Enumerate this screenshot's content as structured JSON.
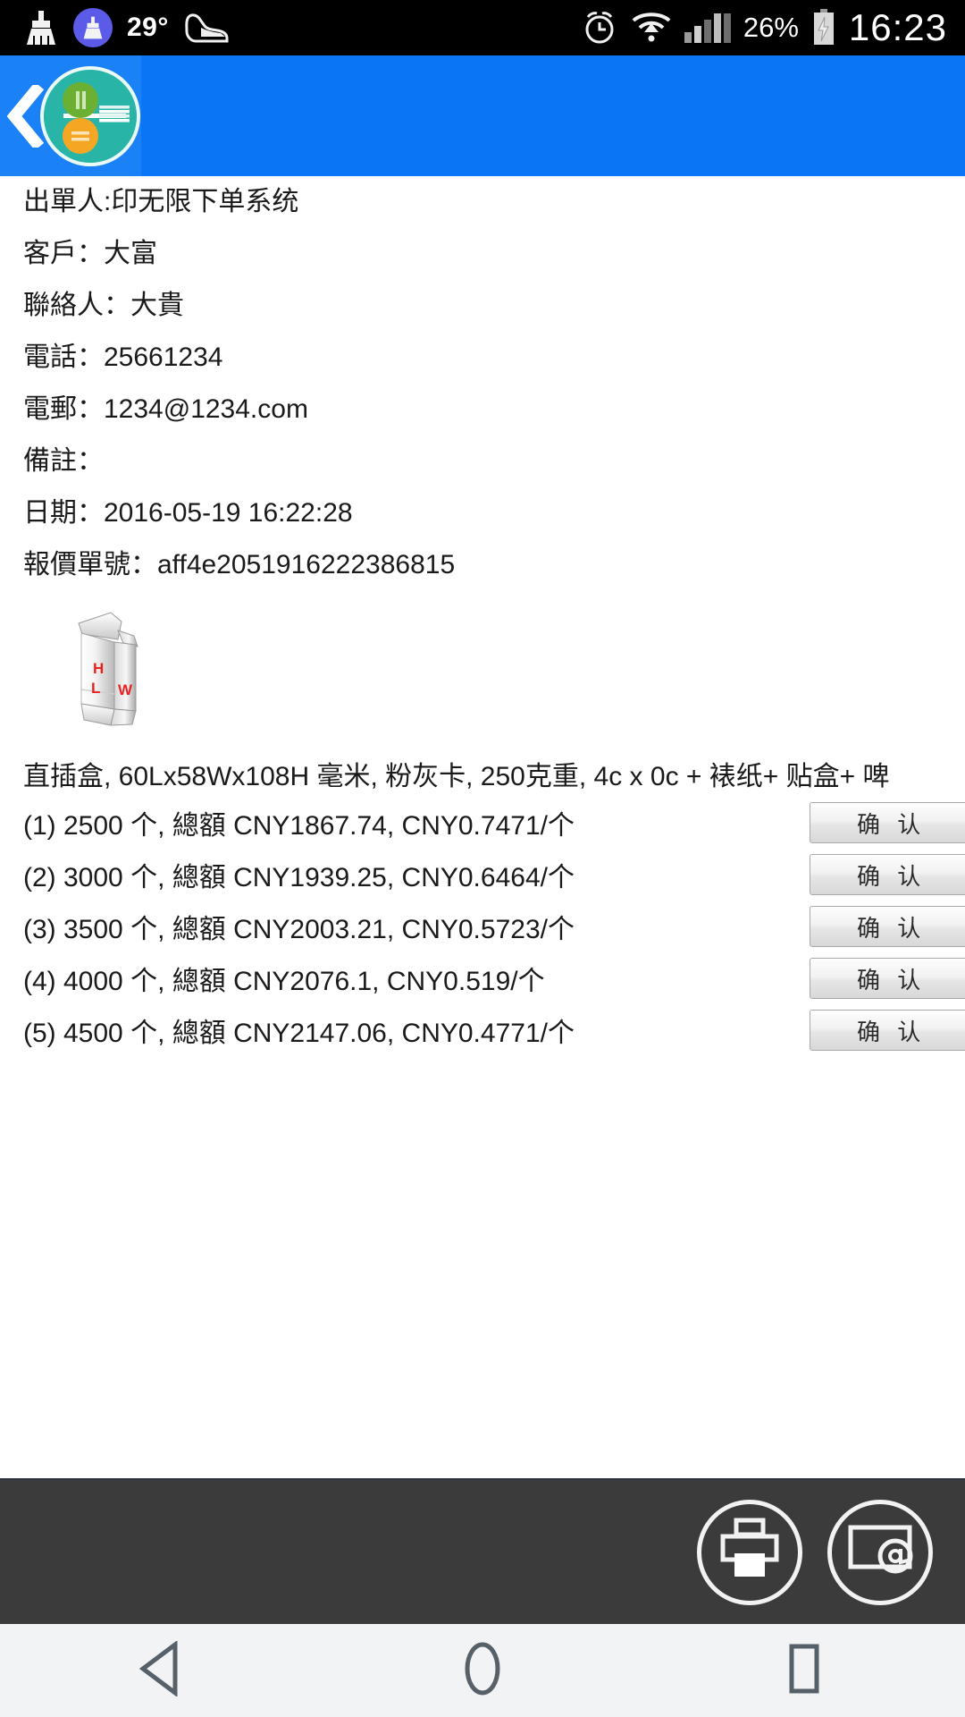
{
  "status_bar": {
    "temperature": "29°",
    "battery_percent": "26%",
    "clock": "16:23",
    "icons": [
      "broom-icon",
      "broom-badge-icon",
      "shoe-icon",
      "alarm-icon",
      "wifi-icon",
      "signal-icon",
      "battery-charging-icon"
    ]
  },
  "app_bar": {
    "back_label": "chevron-left-icon",
    "logo_label": "app-logo"
  },
  "order": {
    "issuer_label": "出單人:",
    "issuer_value": "印无限下单系统",
    "customer_label": "客戶：",
    "customer_value": "大富",
    "contact_label": "聯絡人：",
    "contact_value": "大貴",
    "phone_label": "電話：",
    "phone_value": "25661234",
    "email_label": "電郵：",
    "email_value": "1234@1234.com",
    "remark_label": "備註：",
    "remark_value": "",
    "date_label": "日期：",
    "date_value": "2016-05-19 16:22:28",
    "quote_label": "報價單號：",
    "quote_value": "aff4e2051916222386815"
  },
  "diagram": {
    "alt": "straight-tuck-end-carton-diagram",
    "label_h": "H",
    "label_l": "L",
    "label_w": "W",
    "label_color": "#e8231f"
  },
  "product": {
    "description": "直插盒, 60Lx58Wx108H 毫米, 粉灰卡, 250克重, 4c x 0c + 裱纸+ 贴盒+ 啤"
  },
  "quotes": [
    {
      "index": "(1)",
      "text": "(1) 2500 个, 總額 CNY1867.74, CNY0.7471/个",
      "quantity": 2500,
      "total": "CNY1867.74",
      "unit_price": "CNY0.7471/个",
      "confirm_label": "确 认"
    },
    {
      "index": "(2)",
      "text": "(2) 3000 个, 總額 CNY1939.25, CNY0.6464/个",
      "quantity": 3000,
      "total": "CNY1939.25",
      "unit_price": "CNY0.6464/个",
      "confirm_label": "确 认"
    },
    {
      "index": "(3)",
      "text": "(3) 3500 个, 總額 CNY2003.21, CNY0.5723/个",
      "quantity": 3500,
      "total": "CNY2003.21",
      "unit_price": "CNY0.5723/个",
      "confirm_label": "确 认"
    },
    {
      "index": "(4)",
      "text": "(4) 4000 个, 總額 CNY2076.1, CNY0.519/个",
      "quantity": 4000,
      "total": "CNY2076.1",
      "unit_price": "CNY0.519/个",
      "confirm_label": "确 认"
    },
    {
      "index": "(5)",
      "text": "(5) 4500 个, 總額 CNY2147.06, CNY0.4771/个",
      "quantity": 4500,
      "total": "CNY2147.06",
      "unit_price": "CNY0.4771/个",
      "confirm_label": "确 认"
    }
  ],
  "toolbar": {
    "print_label": "printer-icon",
    "email_label": "email-icon"
  },
  "nav_bar": {
    "back_label": "back-triangle-icon",
    "home_label": "home-circle-icon",
    "recents_label": "recents-square-icon"
  },
  "colors": {
    "app_bar_blue": "#0b76f5",
    "logo_teal": "#28b5a8",
    "logo_green": "#6cb033",
    "logo_orange": "#f5a623",
    "toolbar_dark": "#3b3b3b",
    "nav_bg": "#f2f3f5",
    "diagram_red": "#e8231f"
  }
}
